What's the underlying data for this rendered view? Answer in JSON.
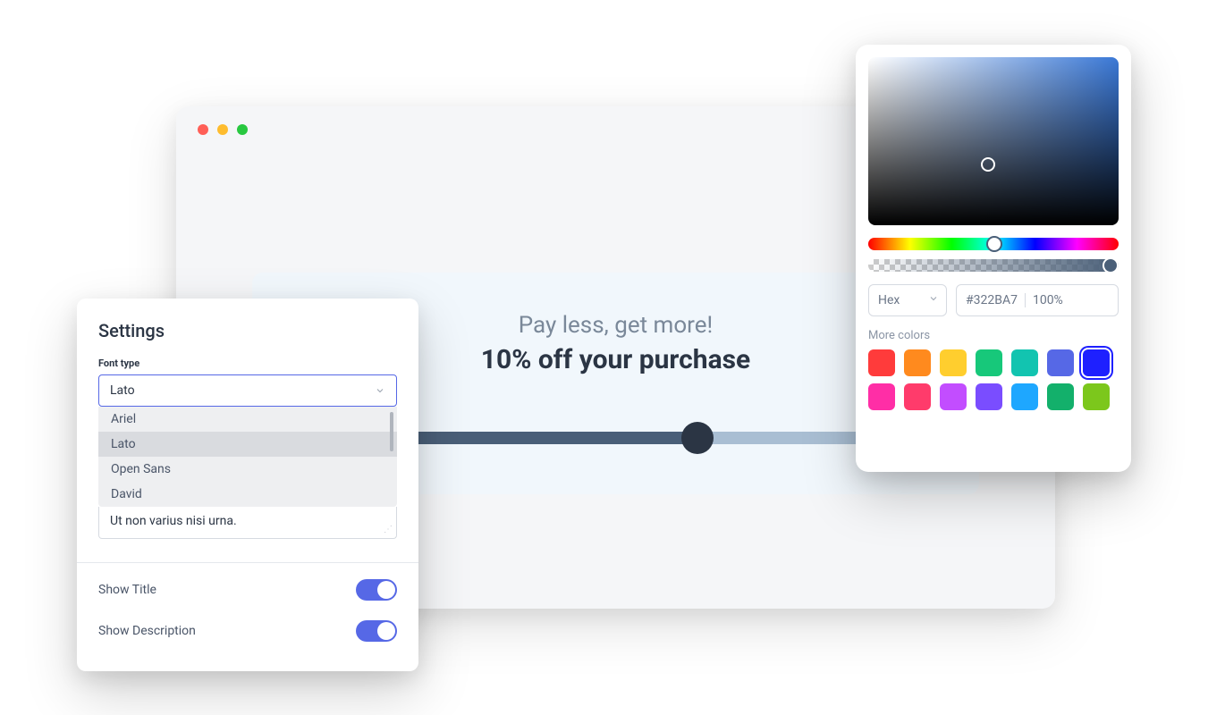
{
  "browser": {
    "traffic_lights": [
      "close",
      "minimize",
      "maximize"
    ]
  },
  "promo": {
    "subtitle": "Pay less, get more!",
    "title": "10% off your purchase",
    "slider_value": 61
  },
  "settings": {
    "title": "Settings",
    "font_type_label": "Font type",
    "selected_font": "Lato",
    "font_options": [
      "Ariel",
      "Lato",
      "Open Sans",
      "David"
    ],
    "textarea_text": "Ut non varius nisi urna.",
    "toggles": [
      {
        "label": "Show Title",
        "on": true
      },
      {
        "label": "Show Description",
        "on": true
      }
    ]
  },
  "color_picker": {
    "format_label": "Hex",
    "hex_value": "#322BA7",
    "opacity": "100%",
    "more_colors_label": "More colors",
    "swatches_row1": [
      "#ff3b3b",
      "#ff8a1e",
      "#ffce2e",
      "#17c87a",
      "#12c4b0",
      "#5668e6",
      "#1e20ff"
    ],
    "swatches_row2": [
      "#ff2ea6",
      "#ff3b6b",
      "#c24dff",
      "#7a4dff",
      "#1ea7ff",
      "#13b06b",
      "#7cc71c"
    ],
    "selected_swatch": "#1e20ff"
  }
}
